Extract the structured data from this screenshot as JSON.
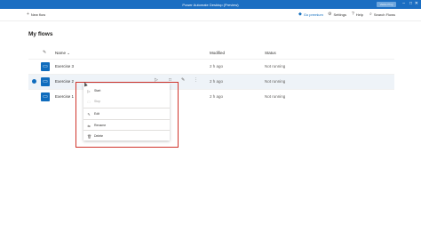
{
  "window": {
    "title": "Power Automate Desktop (Preview)",
    "user": "Vasile Ping"
  },
  "toolbar": {
    "new_flow": "New flow",
    "go_premium": "Go premium",
    "settings": "Settings",
    "help": "Help",
    "search": "Search Flows"
  },
  "page": {
    "title": "My flows"
  },
  "table": {
    "columns": {
      "name": "Name",
      "modified": "Modified",
      "status": "Status"
    },
    "rows": [
      {
        "name": "Exercise 3",
        "modified": "2 h ago",
        "status": "Not running"
      },
      {
        "name": "Exercise 2",
        "modified": "2 h ago",
        "status": "Not running"
      },
      {
        "name": "Exercise 1",
        "modified": "2 h ago",
        "status": "Not running"
      }
    ]
  },
  "context_menu": {
    "start": "Start",
    "stop": "Stop",
    "edit": "Edit",
    "rename": "Rename",
    "delete": "Delete"
  },
  "colors": {
    "accent": "#0f6cbd",
    "titlebar": "#1b6ec2",
    "highlight": "#d0342c"
  },
  "icons": [
    "flow-icon",
    "play-icon",
    "stop-icon",
    "pencil-icon",
    "rename-icon",
    "trash-icon"
  ]
}
